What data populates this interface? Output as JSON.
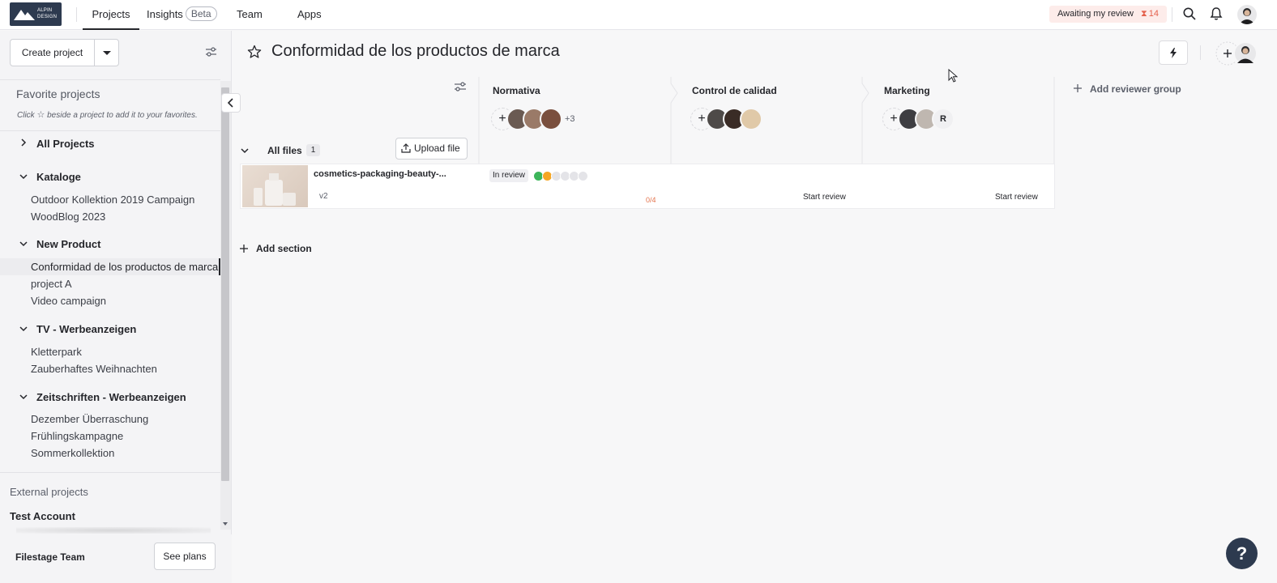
{
  "topbar": {
    "logo_text_line1": "ALPIN",
    "logo_text_line2": "DESIGN",
    "nav": [
      {
        "label": "Projects"
      },
      {
        "label": "Insights"
      },
      {
        "label": "Team"
      },
      {
        "label": "Apps"
      }
    ],
    "beta_badge": "Beta",
    "awaiting_label": "Awaiting my review",
    "awaiting_count": "14"
  },
  "sidebar": {
    "create_project": "Create project",
    "favorites_title": "Favorite projects",
    "favorites_hint_pre": "Click",
    "favorites_hint_post": "beside a project to add it to your favorites.",
    "groups": [
      {
        "label": "All Projects",
        "expanded": false,
        "projects": []
      },
      {
        "label": "Kataloge",
        "expanded": true,
        "projects": [
          "Outdoor Kollektion 2019 Campaign",
          "WoodBlog 2023"
        ]
      },
      {
        "label": "New Product",
        "expanded": true,
        "projects": [
          "Conformidad de los productos de marca",
          "project A",
          "Video campaign"
        ]
      },
      {
        "label": "TV - Werbeanzeigen",
        "expanded": true,
        "projects": [
          "Kletterpark",
          "Zauberhaftes Weihnachten"
        ]
      },
      {
        "label": "Zeitschriften - Werbeanzeigen",
        "expanded": true,
        "projects": [
          "Dezember Überraschung",
          "Frühlingskampagne",
          "Sommerkollektion"
        ]
      }
    ],
    "external_title": "External projects",
    "external_account": "Test Account",
    "team_name": "Filestage Team",
    "see_plans": "See plans"
  },
  "main": {
    "project_title": "Conformidad de los productos de marca",
    "all_files": "All files",
    "file_count": "1",
    "upload_file": "Upload file",
    "add_section": "Add section",
    "add_reviewer_group": "Add reviewer group",
    "reviewer_groups": [
      {
        "name": "Normativa",
        "extra": "+3"
      },
      {
        "name": "Control de calidad",
        "extra": ""
      },
      {
        "name": "Marketing",
        "extra": "R"
      }
    ],
    "file": {
      "name": "cosmetics-packaging-beauty-...",
      "version": "v2",
      "status": "In review",
      "progress": "0/4",
      "start_review": "Start review"
    },
    "help": "?"
  },
  "colors": {
    "brand": "#2d3a4f",
    "awaiting_bg": "#fdecea",
    "awaiting_count": "#e4614d",
    "dot_green": "#3cb55a",
    "dot_orange": "#f5a623",
    "dot_empty": "#e4e4e8"
  }
}
